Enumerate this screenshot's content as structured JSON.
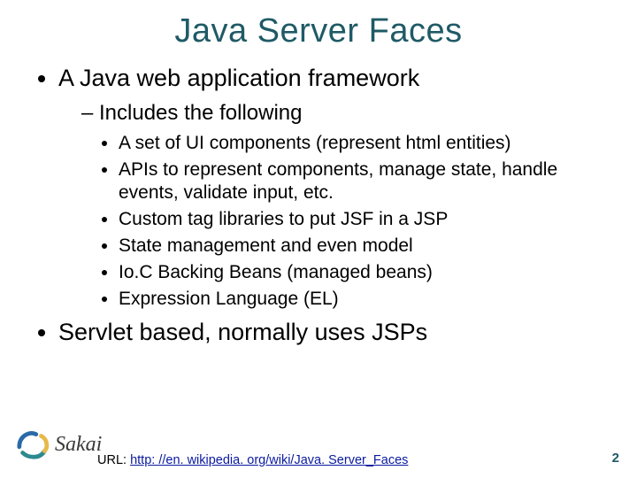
{
  "title": "Java Server Faces",
  "bullets": {
    "b1": "A Java web application framework",
    "b1_sub1": "Includes the following",
    "b1_sub1_items": [
      "A set of UI components (represent html entities)",
      "APIs to represent components, manage state, handle events, validate input, etc.",
      "Custom tag libraries to put JSF in a JSP",
      "State management and even model",
      "Io.C Backing Beans (managed beans)",
      "Expression Language (EL)"
    ],
    "b2": "Servlet based, normally uses JSPs"
  },
  "footer": {
    "url_label": "URL: ",
    "url_text": "http: //en. wikipedia. org/wiki/Java. Server_Faces",
    "logo_text": "Sakai",
    "page_number": "2"
  },
  "colors": {
    "accent": "#1f5a66",
    "link": "#0a1aa0",
    "logo_blue": "#2b6aa8",
    "logo_teal": "#2c8a8f",
    "logo_yellow": "#e7b94a"
  }
}
